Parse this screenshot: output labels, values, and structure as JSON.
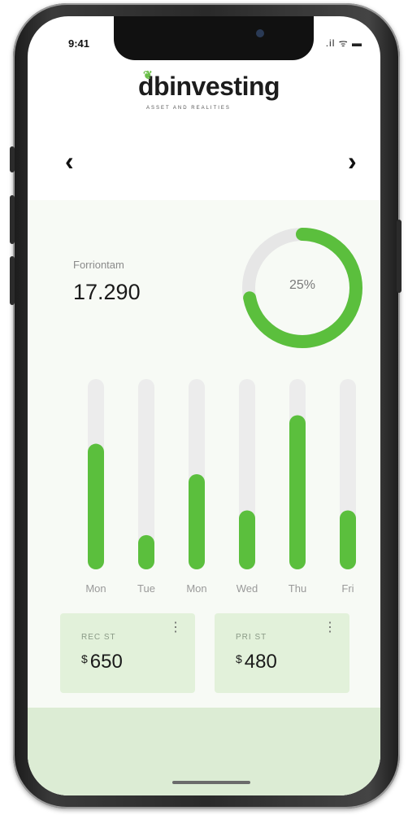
{
  "status_bar": {
    "time": "9:41",
    "icons": ".il ᯤ ▬"
  },
  "brand": {
    "logo_text": "dbinvesting",
    "tagline": "ASSET AND REALITIES"
  },
  "nav": {
    "prev": "‹",
    "next": "›"
  },
  "metric": {
    "label": "Forriontam",
    "value": "17.290"
  },
  "donut": {
    "percent_label": "25%",
    "fill_fraction": 0.72,
    "color": "#5bbf3d",
    "track_color": "#e6e6e6"
  },
  "chart_data": {
    "type": "bar",
    "categories": [
      "Mon",
      "Tue",
      "Mon",
      "Wed",
      "Thu",
      "Fri"
    ],
    "values": [
      0.66,
      0.18,
      0.5,
      0.31,
      0.81,
      0.31
    ],
    "ylim": [
      0,
      1
    ],
    "bar_color": "#5bbf3d",
    "track_color": "#ececec"
  },
  "cards": [
    {
      "label": "REC ST",
      "currency": "$",
      "value": "650"
    },
    {
      "label": "PRI ST",
      "currency": "$",
      "value": "480"
    }
  ]
}
